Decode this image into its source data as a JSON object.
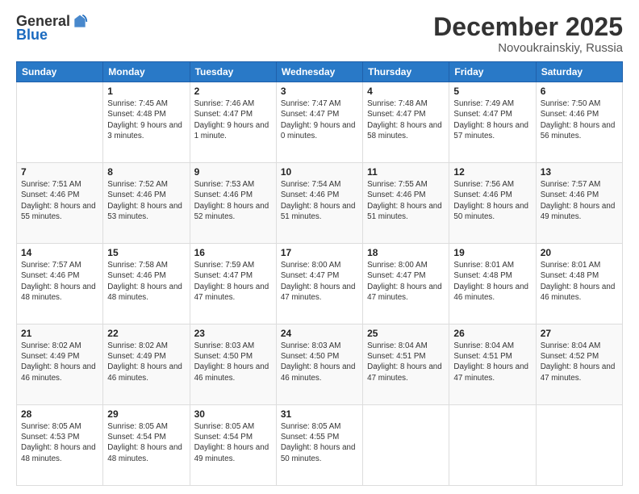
{
  "logo": {
    "general": "General",
    "blue": "Blue"
  },
  "header": {
    "month": "December 2025",
    "location": "Novoukrainskiy, Russia"
  },
  "weekdays": [
    "Sunday",
    "Monday",
    "Tuesday",
    "Wednesday",
    "Thursday",
    "Friday",
    "Saturday"
  ],
  "weeks": [
    [
      {
        "day": null,
        "info": null
      },
      {
        "day": "1",
        "info": "Sunrise: 7:45 AM\nSunset: 4:48 PM\nDaylight: 9 hours\nand 3 minutes."
      },
      {
        "day": "2",
        "info": "Sunrise: 7:46 AM\nSunset: 4:47 PM\nDaylight: 9 hours\nand 1 minute."
      },
      {
        "day": "3",
        "info": "Sunrise: 7:47 AM\nSunset: 4:47 PM\nDaylight: 9 hours\nand 0 minutes."
      },
      {
        "day": "4",
        "info": "Sunrise: 7:48 AM\nSunset: 4:47 PM\nDaylight: 8 hours\nand 58 minutes."
      },
      {
        "day": "5",
        "info": "Sunrise: 7:49 AM\nSunset: 4:47 PM\nDaylight: 8 hours\nand 57 minutes."
      },
      {
        "day": "6",
        "info": "Sunrise: 7:50 AM\nSunset: 4:46 PM\nDaylight: 8 hours\nand 56 minutes."
      }
    ],
    [
      {
        "day": "7",
        "info": "Sunrise: 7:51 AM\nSunset: 4:46 PM\nDaylight: 8 hours\nand 55 minutes."
      },
      {
        "day": "8",
        "info": "Sunrise: 7:52 AM\nSunset: 4:46 PM\nDaylight: 8 hours\nand 53 minutes."
      },
      {
        "day": "9",
        "info": "Sunrise: 7:53 AM\nSunset: 4:46 PM\nDaylight: 8 hours\nand 52 minutes."
      },
      {
        "day": "10",
        "info": "Sunrise: 7:54 AM\nSunset: 4:46 PM\nDaylight: 8 hours\nand 51 minutes."
      },
      {
        "day": "11",
        "info": "Sunrise: 7:55 AM\nSunset: 4:46 PM\nDaylight: 8 hours\nand 51 minutes."
      },
      {
        "day": "12",
        "info": "Sunrise: 7:56 AM\nSunset: 4:46 PM\nDaylight: 8 hours\nand 50 minutes."
      },
      {
        "day": "13",
        "info": "Sunrise: 7:57 AM\nSunset: 4:46 PM\nDaylight: 8 hours\nand 49 minutes."
      }
    ],
    [
      {
        "day": "14",
        "info": "Sunrise: 7:57 AM\nSunset: 4:46 PM\nDaylight: 8 hours\nand 48 minutes."
      },
      {
        "day": "15",
        "info": "Sunrise: 7:58 AM\nSunset: 4:46 PM\nDaylight: 8 hours\nand 48 minutes."
      },
      {
        "day": "16",
        "info": "Sunrise: 7:59 AM\nSunset: 4:47 PM\nDaylight: 8 hours\nand 47 minutes."
      },
      {
        "day": "17",
        "info": "Sunrise: 8:00 AM\nSunset: 4:47 PM\nDaylight: 8 hours\nand 47 minutes."
      },
      {
        "day": "18",
        "info": "Sunrise: 8:00 AM\nSunset: 4:47 PM\nDaylight: 8 hours\nand 47 minutes."
      },
      {
        "day": "19",
        "info": "Sunrise: 8:01 AM\nSunset: 4:48 PM\nDaylight: 8 hours\nand 46 minutes."
      },
      {
        "day": "20",
        "info": "Sunrise: 8:01 AM\nSunset: 4:48 PM\nDaylight: 8 hours\nand 46 minutes."
      }
    ],
    [
      {
        "day": "21",
        "info": "Sunrise: 8:02 AM\nSunset: 4:49 PM\nDaylight: 8 hours\nand 46 minutes."
      },
      {
        "day": "22",
        "info": "Sunrise: 8:02 AM\nSunset: 4:49 PM\nDaylight: 8 hours\nand 46 minutes."
      },
      {
        "day": "23",
        "info": "Sunrise: 8:03 AM\nSunset: 4:50 PM\nDaylight: 8 hours\nand 46 minutes."
      },
      {
        "day": "24",
        "info": "Sunrise: 8:03 AM\nSunset: 4:50 PM\nDaylight: 8 hours\nand 46 minutes."
      },
      {
        "day": "25",
        "info": "Sunrise: 8:04 AM\nSunset: 4:51 PM\nDaylight: 8 hours\nand 47 minutes."
      },
      {
        "day": "26",
        "info": "Sunrise: 8:04 AM\nSunset: 4:51 PM\nDaylight: 8 hours\nand 47 minutes."
      },
      {
        "day": "27",
        "info": "Sunrise: 8:04 AM\nSunset: 4:52 PM\nDaylight: 8 hours\nand 47 minutes."
      }
    ],
    [
      {
        "day": "28",
        "info": "Sunrise: 8:05 AM\nSunset: 4:53 PM\nDaylight: 8 hours\nand 48 minutes."
      },
      {
        "day": "29",
        "info": "Sunrise: 8:05 AM\nSunset: 4:54 PM\nDaylight: 8 hours\nand 48 minutes."
      },
      {
        "day": "30",
        "info": "Sunrise: 8:05 AM\nSunset: 4:54 PM\nDaylight: 8 hours\nand 49 minutes."
      },
      {
        "day": "31",
        "info": "Sunrise: 8:05 AM\nSunset: 4:55 PM\nDaylight: 8 hours\nand 50 minutes."
      },
      {
        "day": null,
        "info": null
      },
      {
        "day": null,
        "info": null
      },
      {
        "day": null,
        "info": null
      }
    ]
  ]
}
